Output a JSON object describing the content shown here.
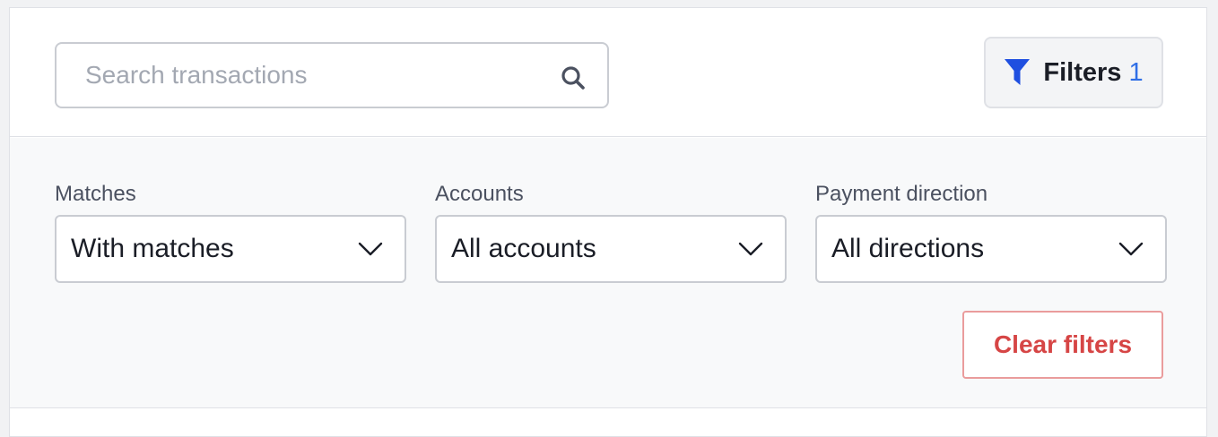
{
  "search": {
    "placeholder": "Search transactions",
    "value": ""
  },
  "filters_button": {
    "label": "Filters",
    "count": "1"
  },
  "filter_groups": [
    {
      "label": "Matches",
      "value": "With matches"
    },
    {
      "label": "Accounts",
      "value": "All accounts"
    },
    {
      "label": "Payment direction",
      "value": "All directions"
    }
  ],
  "clear_button": {
    "label": "Clear filters"
  },
  "colors": {
    "accent_blue": "#2f6ee6",
    "funnel_blue": "#1f4fe0",
    "danger_red": "#d64545",
    "danger_border": "#ea9c9c"
  },
  "icons": {
    "search": "search-icon",
    "filter": "funnel-icon",
    "dropdown": "chevron-down-icon"
  }
}
